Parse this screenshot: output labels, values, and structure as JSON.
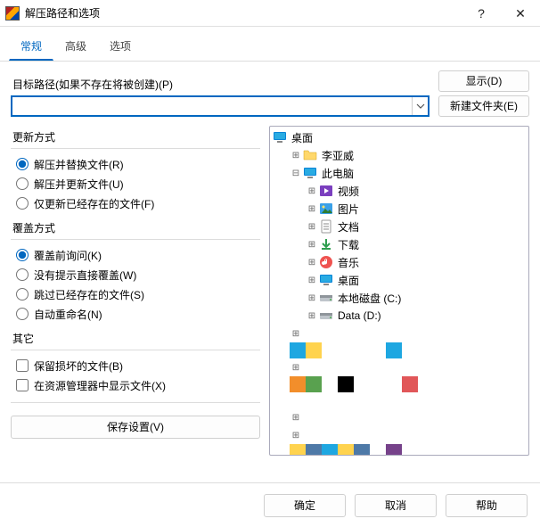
{
  "window": {
    "title": "解压路径和选项",
    "help": "?",
    "close": "✕"
  },
  "tabs": [
    "常规",
    "高级",
    "选项"
  ],
  "path": {
    "label": "目标路径(如果不存在将被创建)(P)",
    "value": "",
    "display_btn": "显示(D)",
    "newfolder_btn": "新建文件夹(E)"
  },
  "groups": {
    "update": {
      "title": "更新方式",
      "options": [
        "解压并替换文件(R)",
        "解压并更新文件(U)",
        "仅更新已经存在的文件(F)"
      ],
      "selected": 0
    },
    "overwrite": {
      "title": "覆盖方式",
      "options": [
        "覆盖前询问(K)",
        "没有提示直接覆盖(W)",
        "跳过已经存在的文件(S)",
        "自动重命名(N)"
      ],
      "selected": 0
    },
    "misc": {
      "title": "其它",
      "options": [
        "保留损坏的文件(B)",
        "在资源管理器中显示文件(X)"
      ]
    }
  },
  "save_settings_btn": "保存设置(V)",
  "tree": {
    "root": "桌面",
    "items": [
      {
        "indent": 1,
        "expand": "+",
        "icon": "folder",
        "label": "李亚威"
      },
      {
        "indent": 1,
        "expand": "-",
        "icon": "pc",
        "label": "此电脑"
      },
      {
        "indent": 2,
        "expand": "+",
        "icon": "video",
        "label": "视频"
      },
      {
        "indent": 2,
        "expand": "+",
        "icon": "image",
        "label": "图片"
      },
      {
        "indent": 2,
        "expand": "+",
        "icon": "doc",
        "label": "文档"
      },
      {
        "indent": 2,
        "expand": "+",
        "icon": "download",
        "label": "下载"
      },
      {
        "indent": 2,
        "expand": "+",
        "icon": "music",
        "label": "音乐"
      },
      {
        "indent": 2,
        "expand": "+",
        "icon": "desktop",
        "label": "桌面"
      },
      {
        "indent": 2,
        "expand": "+",
        "icon": "drive",
        "label": "本地磁盘 (C:)"
      },
      {
        "indent": 2,
        "expand": "+",
        "icon": "drive",
        "label": "Data (D:)"
      }
    ]
  },
  "footer": {
    "ok": "确定",
    "cancel": "取消",
    "help": "帮助"
  },
  "mosaic_colors": {
    "r1": [
      "#1ea7e1",
      "#ffd34e",
      "",
      "",
      "",
      "",
      "#1ea7e1",
      "",
      "",
      ""
    ],
    "r2": [
      "#f28e2b",
      "#59a14f",
      "",
      "#000000",
      "",
      "",
      "",
      "#e15759",
      "",
      ""
    ],
    "r4": [
      "#ffd34e",
      "#4e79a7",
      "#1ea7e1",
      "#ffd34e",
      "#4e79a7",
      "",
      "#76428a",
      "",
      "",
      ""
    ]
  }
}
